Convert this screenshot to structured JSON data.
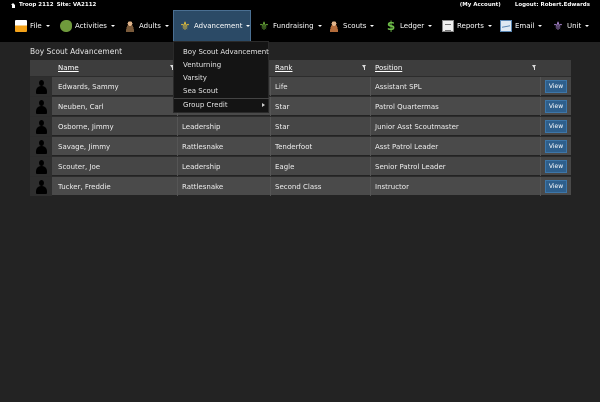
{
  "topbar": {
    "troop": "Troop 2112",
    "site": "Site: VA2112",
    "my_account": "(My Account)",
    "logout": "Logout: Robert.Edwards"
  },
  "nav": {
    "items": [
      {
        "label": "File",
        "icon": "file-icon"
      },
      {
        "label": "Activities",
        "icon": "activities-icon"
      },
      {
        "label": "Adults",
        "icon": "adults-icon"
      },
      {
        "label": "Advancement",
        "icon": "fleur-de-lis-icon"
      },
      {
        "label": "Fundraising",
        "icon": "fundraising-icon"
      },
      {
        "label": "Scouts",
        "icon": "scouts-icon"
      },
      {
        "label": "Ledger",
        "icon": "dollar-icon"
      },
      {
        "label": "Reports",
        "icon": "reports-icon"
      },
      {
        "label": "Email",
        "icon": "email-icon"
      },
      {
        "label": "Unit",
        "icon": "unit-icon"
      }
    ],
    "active": "Advancement"
  },
  "dropdown": {
    "items": [
      "Boy Scout Advancement",
      "Venturning",
      "Varsity",
      "Sea Scout",
      "Group Credit"
    ]
  },
  "panel": {
    "title": "Boy Scout Advancement",
    "columns": {
      "name": "Name",
      "rank": "Rank",
      "position": "Position"
    },
    "view_label": "View",
    "rows": [
      {
        "name": "Edwards, Sammy",
        "patrol": "",
        "rank": "Life",
        "position": "Assistant SPL"
      },
      {
        "name": "Neuben, Carl",
        "patrol": "",
        "rank": "Star",
        "position": "Patrol Quartermas"
      },
      {
        "name": "Osborne, Jimmy",
        "patrol": "Leadership",
        "rank": "Star",
        "position": "Junior Asst Scoutmaster"
      },
      {
        "name": "Savage, Jimmy",
        "patrol": "Rattlesnake",
        "rank": "Tenderfoot",
        "position": "Asst Patrol Leader"
      },
      {
        "name": "Scouter, Joe",
        "patrol": "Leadership",
        "rank": "Eagle",
        "position": "Senior Patrol Leader"
      },
      {
        "name": "Tucker, Freddie",
        "patrol": "Rattlesnake",
        "rank": "Second Class",
        "position": "Instructor"
      }
    ]
  },
  "colors": {
    "background": "#232323",
    "navbar": "#000000",
    "active_nav": "#2b4a66",
    "view_button": "#2e5f8c"
  }
}
